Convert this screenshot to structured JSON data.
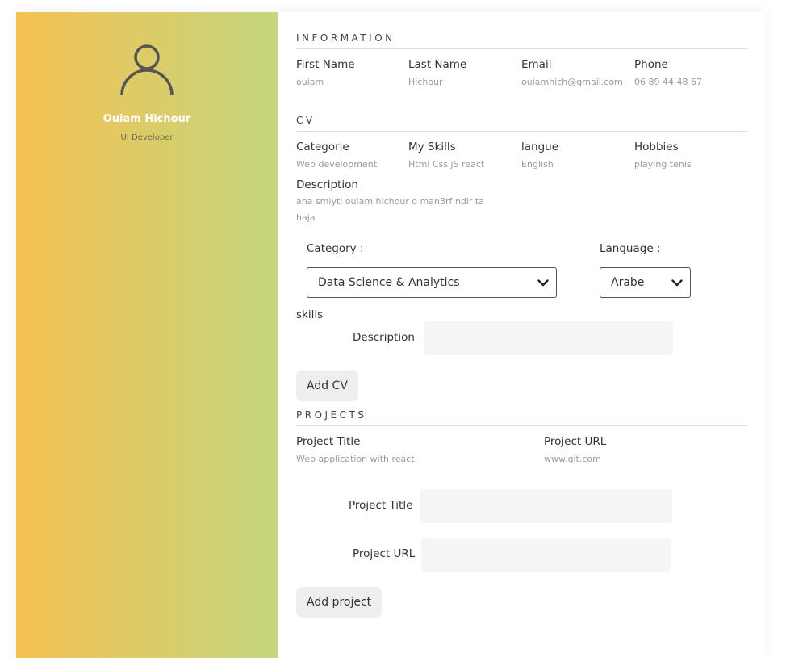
{
  "profile": {
    "name": "Ouiam Hichour",
    "role": "UI Developer"
  },
  "information": {
    "title": "INFORMATION",
    "fields": [
      {
        "label": "First Name",
        "value": "ouiam"
      },
      {
        "label": "Last Name",
        "value": "Hichour"
      },
      {
        "label": "Email",
        "value": "ouiamhich@gmail.com"
      },
      {
        "label": "Phone",
        "value": "06 89 44 48 67"
      }
    ]
  },
  "cv": {
    "title": "CV",
    "fields": [
      {
        "label": "Categorie",
        "value": "Web development"
      },
      {
        "label": "My Skills",
        "value": "Html Css jS react"
      },
      {
        "label": "langue",
        "value": "English"
      },
      {
        "label": "Hobbies",
        "value": "playing tenis"
      }
    ],
    "description_label": "Description",
    "description_value": "ana smiyti ouiam hichour o man3rf ndir ta haja"
  },
  "cv_form": {
    "category_label": "Category :",
    "category_selected": "Data Science & Analytics",
    "language_label": "Language :",
    "language_selected": "Arabe",
    "skills_label": "skills",
    "description_label": "Description",
    "add_button": "Add CV"
  },
  "projects": {
    "title": "PROJECTS",
    "fields": [
      {
        "label": "Project Title",
        "value": "Web application with react"
      },
      {
        "label": "Project URL",
        "value": "www.git.com"
      }
    ]
  },
  "project_form": {
    "title_label": "Project Title",
    "url_label": "Project URL",
    "add_button": "Add project"
  },
  "colors": {
    "sidebar_gradient_start": "#f4c152",
    "sidebar_gradient_end": "#c4d67e",
    "input_background": "#f5f5f5"
  }
}
